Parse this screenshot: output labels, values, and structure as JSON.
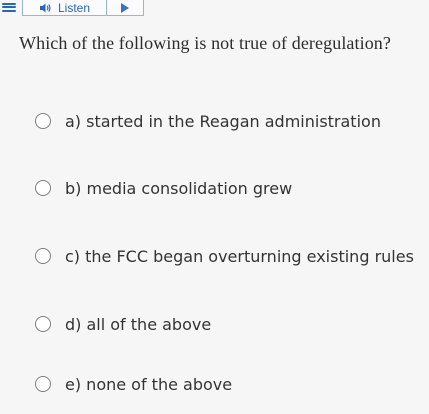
{
  "toolbar": {
    "menu_icon": "hamburger-menu-icon",
    "listen_label": "Listen",
    "speaker_icon": "speaker-icon",
    "play_icon": "play-icon"
  },
  "question": {
    "text": "Which of the following is not true of deregulation?"
  },
  "options": [
    {
      "text": "a) started in the Reagan administration"
    },
    {
      "text": "b) media consolidation grew"
    },
    {
      "text": "c) the FCC began overturning existing rules"
    },
    {
      "text": "d) all of the above"
    },
    {
      "text": "e) none of the above"
    }
  ],
  "colors": {
    "accent": "#2a66b8",
    "background": "#f6f6f6"
  }
}
